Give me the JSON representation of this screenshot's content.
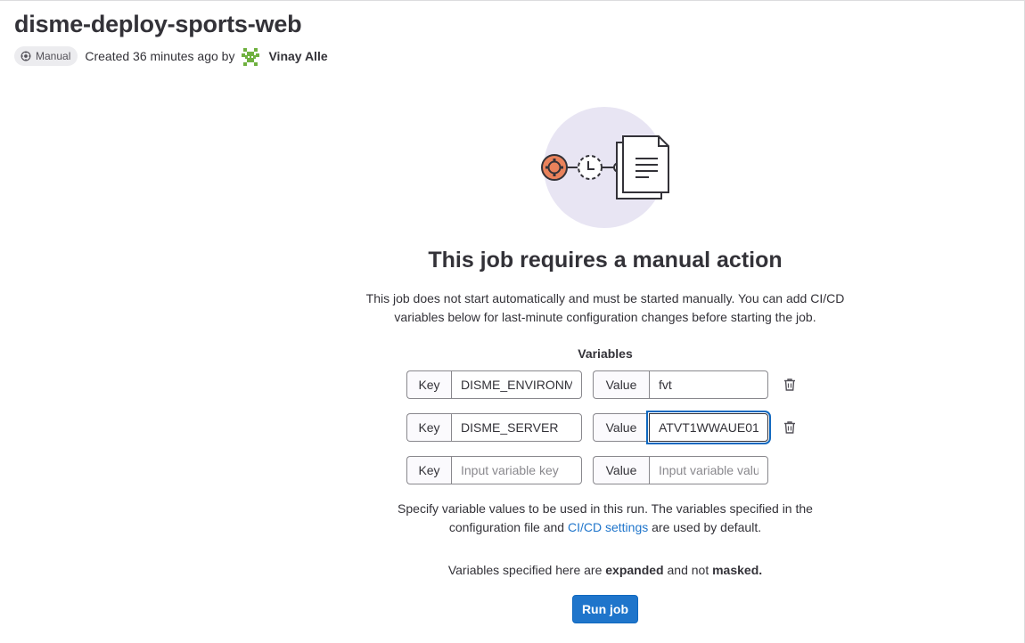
{
  "job": {
    "title": "disme-deploy-sports-web",
    "status_badge": "Manual",
    "created_text": "Created 36 minutes ago by",
    "author": "Vinay Alle"
  },
  "empty_state": {
    "heading": "This job requires a manual action",
    "description": "This job does not start automatically and must be started manually. You can add CI/CD variables below for last-minute configuration changes before starting the job."
  },
  "variables": {
    "label": "Variables",
    "key_addon": "Key",
    "value_addon": "Value",
    "rows": [
      {
        "key": "DISME_ENVIRONMENT",
        "value": "fvt"
      },
      {
        "key": "DISME_SERVER",
        "value": "ATVT1WWAUE01"
      }
    ],
    "new_row": {
      "key_placeholder": "Input variable key",
      "value_placeholder": "Input variable value"
    }
  },
  "hint": {
    "before": "Specify variable values to be used in this run. The variables specified in the configuration file and ",
    "link": "CI/CD settings",
    "after": " are used by default."
  },
  "note": {
    "before": "Variables specified here are ",
    "expanded": "expanded",
    "middle": " and not ",
    "masked": "masked."
  },
  "run_button": "Run job",
  "colors": {
    "accent": "#1f75cb",
    "illustration_bg": "#e8e5f3",
    "gear_orange": "#e9825b"
  },
  "icons": [
    "gear-icon",
    "clock-icon",
    "document-icon",
    "trash-icon",
    "avatar"
  ]
}
